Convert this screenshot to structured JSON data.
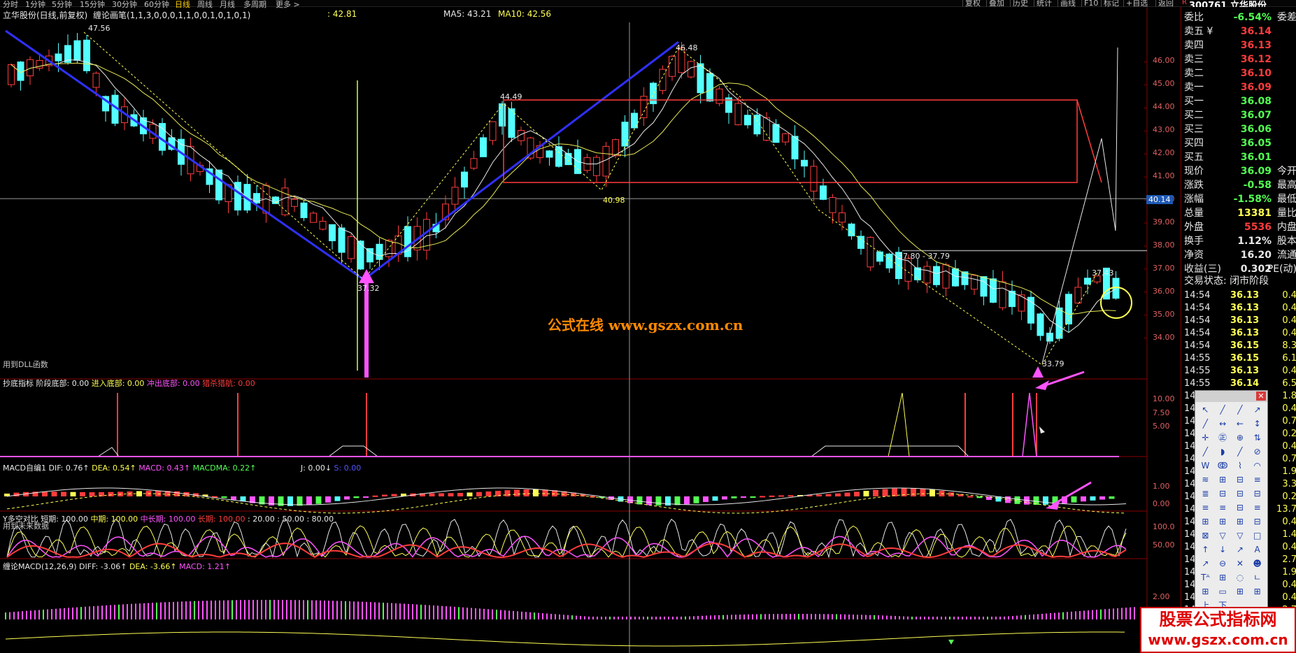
{
  "topbar": {
    "periods": [
      "分时",
      "1分钟",
      "5分钟",
      "15分钟",
      "30分钟",
      "60分钟",
      "日线",
      "周线",
      "月线",
      "多周期",
      "更多 >"
    ],
    "active_period": "日线",
    "buttons": [
      "复权",
      "叠加",
      "历史",
      "统计",
      "画线",
      "F10",
      "标记",
      "+自选",
      "返回"
    ],
    "stock_code": "300761",
    "stock_name": "立华股份",
    "badge": "R"
  },
  "main_panel": {
    "title": "立华股份(日线,前复权)",
    "indicator": "缠论画笔(1,1,3,0,0,0,1,1,0,0,1,0,1,0,1)",
    "indicator_value": ": 42.81",
    "ma5": "MA5: 43.21",
    "ma10": "MA10: 42.56",
    "price_ticks": [
      "46.00",
      "45.00",
      "44.00",
      "43.00",
      "42.00",
      "41.00",
      "40.00",
      "39.00",
      "38.00",
      "37.00",
      "36.00",
      "35.00",
      "34.00"
    ],
    "current_price_tag": "40.14",
    "labels": {
      "high1": "47.56",
      "high2": "46.48",
      "mid_high": "44.49",
      "mid_low": "40.98",
      "low1": "37.32",
      "low2": "33.79",
      "right_high": "37.43",
      "range": "37.80 - 37.79"
    },
    "footnote": "用到DLL函数"
  },
  "panel2": {
    "title": "抄底指标",
    "items": [
      {
        "label": "阶段底部: 0.00",
        "color": "#e8e8e8"
      },
      {
        "label": "进入底部: 0.00",
        "color": "#ffff54"
      },
      {
        "label": "冲出底部: 0.00",
        "color": "#ff54ff"
      },
      {
        "label": "猎杀猎航: 0.00",
        "color": "#ff3c3c"
      }
    ],
    "ticks": [
      "10.00",
      "7.50",
      "5.00"
    ]
  },
  "panel3": {
    "title": "MACD自编1",
    "items": [
      {
        "label": "DIF: 0.76↑",
        "color": "#e8e8e8"
      },
      {
        "label": "DEA: 0.54↑",
        "color": "#ffff54"
      },
      {
        "label": "MACD: 0.43↑",
        "color": "#ff54ff"
      },
      {
        "label": "MACDMA: 0.22↑",
        "color": "#54ff54"
      },
      {
        "label": "J: 0.00↓",
        "color": "#e8e8e8"
      },
      {
        "label": "S: 0.00",
        "color": "#5454ff"
      }
    ],
    "ticks": [
      "1.00",
      "0.00"
    ],
    "footnote": "用到未来数据"
  },
  "panel4": {
    "title": "Y多空对比",
    "items": [
      {
        "label": "短期: 100.00",
        "color": "#e8e8e8"
      },
      {
        "label": "中期: 100.00",
        "color": "#ffff54"
      },
      {
        "label": "中长期: 100.00",
        "color": "#ff54ff"
      },
      {
        "label": "长期: 100.00",
        "color": "#ff3c3c"
      },
      {
        "label": ": 20.00",
        "color": "#e8e8e8"
      },
      {
        "label": ": 50.00",
        "color": "#e8e8e8"
      },
      {
        "label": ": 80.00",
        "color": "#e8e8e8"
      }
    ],
    "ticks": [
      "100.0",
      "50.00"
    ]
  },
  "panel5": {
    "title": "缠论MACD(12,26,9)",
    "items": [
      {
        "label": "DIFF: -3.06↑",
        "color": "#e8e8e8"
      },
      {
        "label": "DEA: -3.66↑",
        "color": "#ffff54"
      },
      {
        "label": "MACD: 1.21↑",
        "color": "#ff54ff"
      }
    ],
    "ticks": [
      "2.00"
    ]
  },
  "quote": {
    "rows": [
      {
        "label": "委比",
        "value": "-6.54%",
        "value_color": "#54ff54",
        "extra": "委差"
      },
      {
        "label": "卖五 ¥",
        "value": "36.14",
        "value_color": "#ff3c3c",
        "extra": ""
      },
      {
        "label": "卖四",
        "value": "36.13",
        "value_color": "#ff3c3c",
        "extra": ""
      },
      {
        "label": "卖三",
        "value": "36.12",
        "value_color": "#ff3c3c",
        "extra": ""
      },
      {
        "label": "卖二",
        "value": "36.10",
        "value_color": "#ff3c3c",
        "extra": ""
      },
      {
        "label": "卖一",
        "value": "36.09",
        "value_color": "#ff3c3c",
        "extra": ""
      },
      {
        "label": "买一",
        "value": "36.08",
        "value_color": "#54ff54",
        "extra": ""
      },
      {
        "label": "买二",
        "value": "36.07",
        "value_color": "#54ff54",
        "extra": ""
      },
      {
        "label": "买三",
        "value": "36.06",
        "value_color": "#54ff54",
        "extra": ""
      },
      {
        "label": "买四",
        "value": "36.05",
        "value_color": "#54ff54",
        "extra": ""
      },
      {
        "label": "买五",
        "value": "36.01",
        "value_color": "#54ff54",
        "extra": ""
      },
      {
        "label": "现价",
        "value": "36.09",
        "value_color": "#54ff54",
        "extra": "今开"
      },
      {
        "label": "涨跌",
        "value": "-0.58",
        "value_color": "#54ff54",
        "extra": "最高"
      },
      {
        "label": "涨幅",
        "value": "-1.58%",
        "value_color": "#54ff54",
        "extra": "最低"
      },
      {
        "label": "总量",
        "value": "13381",
        "value_color": "#ffff54",
        "extra": "量比"
      },
      {
        "label": "外盘",
        "value": "5536",
        "value_color": "#ff3c3c",
        "extra": "内盘"
      },
      {
        "label": "换手",
        "value": "1.12%",
        "value_color": "#e8e8e8",
        "extra": "股本"
      },
      {
        "label": "净资",
        "value": "16.20",
        "value_color": "#e8e8e8",
        "extra": "流通"
      },
      {
        "label": "收益(三)",
        "value": "0.302",
        "value_color": "#e8e8e8",
        "extra": "PE(动)"
      }
    ],
    "trade_status": "交易状态: 闭市阶段",
    "ticks": [
      {
        "time": "14:54",
        "price": "36.13",
        "vol": "0.4"
      },
      {
        "time": "14:54",
        "price": "36.13",
        "vol": "0.4"
      },
      {
        "time": "14:54",
        "price": "36.13",
        "vol": "0.4"
      },
      {
        "time": "14:54",
        "price": "36.13",
        "vol": "0.4"
      },
      {
        "time": "14:54",
        "price": "36.15",
        "vol": "8.3"
      },
      {
        "time": "14:55",
        "price": "36.15",
        "vol": "6.1"
      },
      {
        "time": "14:55",
        "price": "36.13",
        "vol": "0.4"
      },
      {
        "time": "14:55",
        "price": "36.14",
        "vol": "6.5"
      }
    ],
    "partial_tick_time": "14:",
    "partial_vols": [
      "1.8",
      "0.4",
      "0.7",
      "0.2",
      "0.4",
      "0.7",
      "1.9",
      "3.3",
      "0.2",
      "13.7",
      "0.4",
      "1.4",
      "0.4",
      "2.7",
      "1.9",
      "0.4",
      "0.4",
      "2.7",
      "0.4",
      "0.4",
      "0.7"
    ]
  },
  "toolbox": {
    "tools": [
      "↖",
      "╱",
      "╱",
      "↗",
      "╱",
      "↔",
      "←",
      "↕",
      "✛",
      "㊣",
      "⊕",
      "⇅",
      "╱",
      "◗",
      "╱",
      "⊘",
      "W",
      "ↂ",
      "⌇",
      "◠",
      "≋",
      "⊞",
      "⊟",
      "≡",
      "≣",
      "⊟",
      "⊟",
      "⊟",
      "≡",
      "≡",
      "⊟",
      "≡",
      "⊞",
      "⊞",
      "⊞",
      "⊟",
      "⊠",
      "▽",
      "▽",
      "□",
      "↑",
      "↓",
      "↗",
      "A",
      "↗",
      "⊖",
      "✕",
      "☻",
      "Tᴬ",
      "⊞",
      "◌",
      "ㄴ",
      "⊞",
      "▭",
      "⊞",
      "⊞",
      "上",
      "下",
      "",
      ""
    ]
  },
  "watermarks": {
    "center": "公式在线  www.gszx.com.cn",
    "corner_top": "股票公式指标网",
    "corner_bottom": "www.gszx.com.cn"
  }
}
